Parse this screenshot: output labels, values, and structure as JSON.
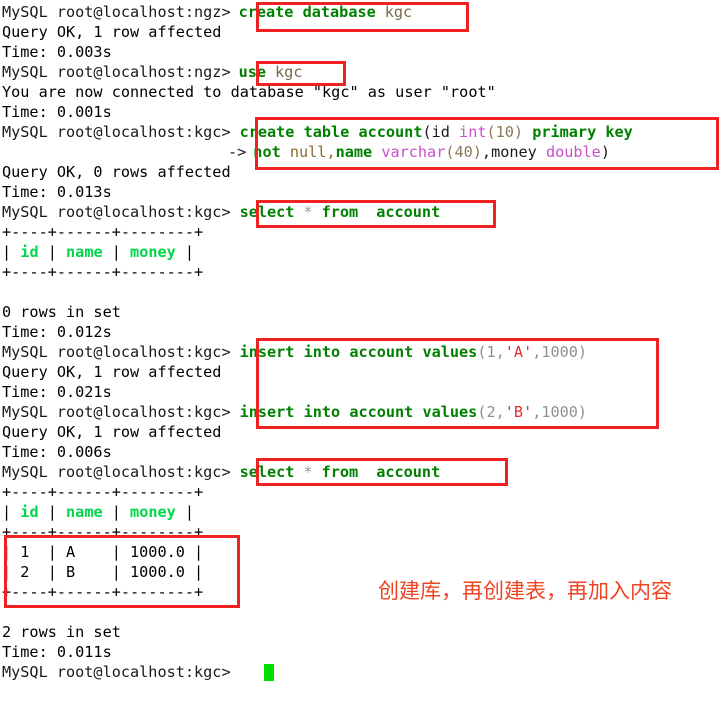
{
  "terminal": {
    "prompt_ngz": "MySQL root@localhost:ngz>",
    "prompt_kgc": "MySQL root@localhost:kgc>",
    "continuation": "->",
    "lines": {
      "l1_prompt": "MySQL root@localhost:ngz>",
      "l1_kw": "create database",
      "l1_arg": "kgc",
      "l2": "Query OK, 1 row affected",
      "l3": "Time: 0.003s",
      "l4_prompt": "MySQL root@localhost:ngz>",
      "l4_kw": "use",
      "l4_arg": "kgc",
      "l5": "You are now connected to database \"kgc\" as user \"root\"",
      "l6": "Time: 0.001s",
      "l7_prompt": "MySQL root@localhost:kgc>",
      "l7_kw1": "create table account",
      "l7_p1": "(id ",
      "l7_type1": "int",
      "l7_num1": "(10)",
      "l7_kw2": " primary key",
      "l8_cont": "->",
      "l8_kw1": "not",
      "l8_null": " null,",
      "l8_kw2": "name",
      "l8_type": " varchar",
      "l8_num": "(40)",
      "l8_p": ",money ",
      "l8_type2": "double",
      "l8_p2": ")",
      "l9": "Query OK, 0 rows affected",
      "l10": "Time: 0.013s",
      "l11_prompt": "MySQL root@localhost:kgc>",
      "l11_kw1": "select",
      "l11_star": "*",
      "l11_kw2": "from",
      "l11_kw3": "account",
      "l12_border": "+----+------+--------+",
      "l13_pipe1": "| ",
      "l13_h1": "id",
      "l13_pipe2": " | ",
      "l13_h2": "name",
      "l13_pipe3": " | ",
      "l13_h3": "money",
      "l13_pipe4": " |",
      "l14_border": "+----+------+--------+",
      "l15": "",
      "l16": "0 rows in set",
      "l17": "Time: 0.012s",
      "l18_prompt": "MySQL root@localhost:kgc>",
      "l18_kw": "insert into account values",
      "l18_p1": "(1,",
      "l18_str": "'A'",
      "l18_p2": ",1000)",
      "l19": "Query OK, 1 row affected",
      "l20": "Time: 0.021s",
      "l21_prompt": "MySQL root@localhost:kgc>",
      "l21_kw": "insert into account values",
      "l21_p1": "(2,",
      "l21_str": "'B'",
      "l21_p2": ",1000)",
      "l22": "Query OK, 1 row affected",
      "l23": "Time: 0.006s",
      "l24_prompt": "MySQL root@localhost:kgc>",
      "l24_kw1": "select",
      "l24_star": "*",
      "l24_kw2": "from",
      "l24_kw3": "account",
      "l25_border": "+----+------+--------+",
      "l26_pipe1": "| ",
      "l26_h1": "id",
      "l26_pipe2": " | ",
      "l26_h2": "name",
      "l26_pipe3": " | ",
      "l26_h3": "money",
      "l26_pipe4": " |",
      "l27_border": "+----+------+--------+",
      "l28_row": "| 1  | A    | 1000.0 |",
      "l29_row": "| 2  | B    | 1000.0 |",
      "l30_border": "+----+------+--------+",
      "l31": "",
      "l32": "2 rows in set",
      "l33": "Time: 0.011s",
      "l34_prompt": "MySQL root@localhost:kgc>"
    },
    "result_tables": [
      {
        "columns": [
          "id",
          "name",
          "money"
        ],
        "rows": [],
        "footer": "0 rows in set",
        "time": "Time: 0.012s"
      },
      {
        "columns": [
          "id",
          "name",
          "money"
        ],
        "rows": [
          [
            "1",
            "A",
            "1000.0"
          ],
          [
            "2",
            "B",
            "1000.0"
          ]
        ],
        "footer": "2 rows in set",
        "time": "Time: 0.011s"
      }
    ],
    "statements": [
      "create database kgc",
      "use kgc",
      "create table account(id int(10) primary key not null,name varchar(40),money double)",
      "select * from  account",
      "insert into account values(1,'A',1000)",
      "insert into account values(2,'B',1000)",
      "select * from  account"
    ]
  },
  "annotation": {
    "text": "创建库，再创建表，再加入内容",
    "color": "#ee4422"
  },
  "colors": {
    "highlight_box": "#ee2222",
    "keyword": "#008000",
    "type": "#c850c8",
    "string": "#e03030",
    "header": "#00d84a",
    "cursor": "#00e000",
    "background": "#ffffff"
  }
}
